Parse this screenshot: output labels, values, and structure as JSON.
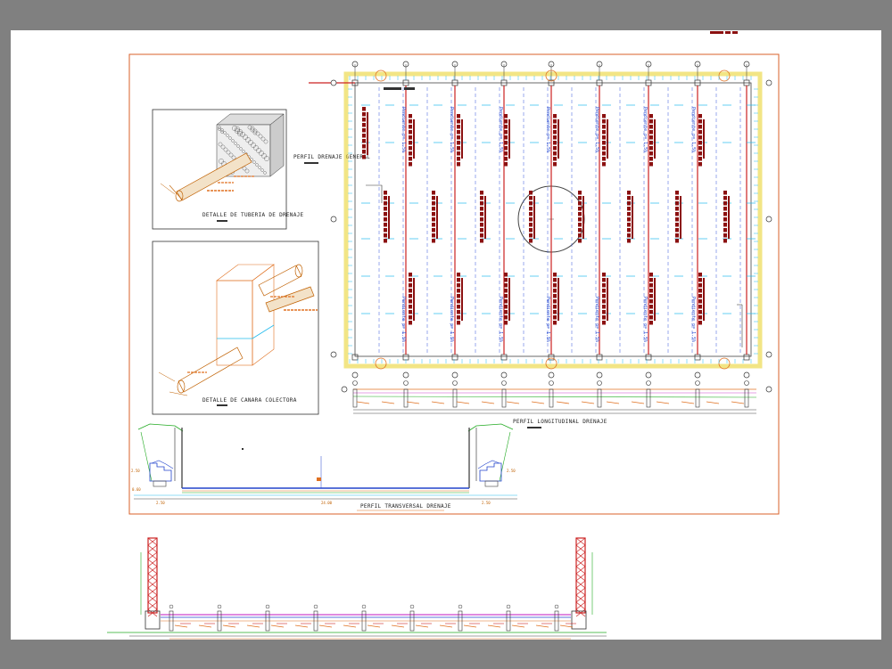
{
  "drawing": {
    "labels": {
      "perfil_general": "PERFIL DRENAJE GENERAL",
      "detalle_tuberia": "DETALLE DE TUBERIA DE DRENAJE",
      "detalle_canaleta": "DETALLE DE CANARA COLECTORA",
      "perfil_longitudinal": "PERFIL LONGITUDINAL DRENAJE",
      "perfil_transversal": "PERFIL TRANSVERSAL DRENAJE"
    },
    "slope_text": "Pendiente p= 1.5%",
    "dims": {
      "d1": "2.50",
      "d2": "0.60",
      "d3": "0.50",
      "total_width": "24.00",
      "d4": "2.50"
    }
  },
  "colors": {
    "background": "#808080",
    "paper": "#ffffff",
    "frame": "#d9602a",
    "drain_red": "#cc2222",
    "drain_dark": "#8b1010",
    "axis_blue": "#3355dd",
    "edge_yellow": "#e8d020",
    "cyan": "#22bbee",
    "orange": "#e07020",
    "green": "#22aa22",
    "magenta": "#cc44cc"
  }
}
